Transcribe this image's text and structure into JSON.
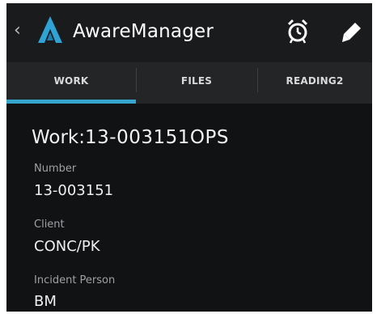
{
  "actionbar": {
    "back_icon": "chevron-left-icon",
    "logo_icon": "awaremanager-logo-icon",
    "title": "AwareManager",
    "actions": [
      {
        "icon": "alarm-clock-icon"
      },
      {
        "icon": "pencil-icon"
      }
    ]
  },
  "tabs": [
    {
      "label": "WORK",
      "selected": true
    },
    {
      "label": "FILES",
      "selected": false
    },
    {
      "label": "READING2",
      "selected": false
    }
  ],
  "work": {
    "title_prefix": "Work:",
    "title_value": "13-003151OPS"
  },
  "fields": [
    {
      "label": "Number",
      "value": "13-003151"
    },
    {
      "label": "Client",
      "value": "CONC/PK"
    },
    {
      "label": "Incident Person",
      "value": "BM"
    }
  ],
  "colors": {
    "accent": "#36a6cf",
    "background": "#111213",
    "actionbar": "#1a1b1c",
    "tabbar": "#232526"
  }
}
